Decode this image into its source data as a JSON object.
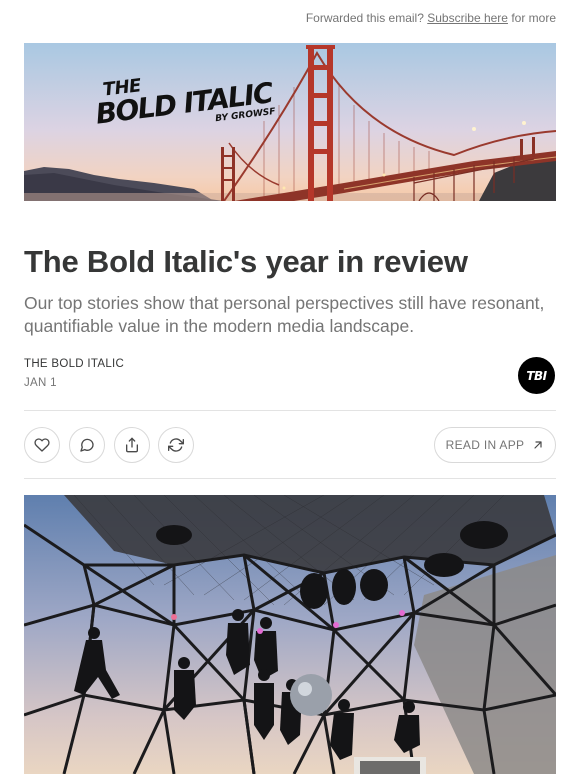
{
  "header": {
    "forward_text": "Forwarded this email?",
    "subscribe_link": "Subscribe here",
    "forward_suffix": "for more"
  },
  "hero_logo": {
    "line1": "THE",
    "line2": "BOLD ITALIC",
    "line3": "BY GROWSF"
  },
  "post": {
    "title": "The Bold Italic's year in review",
    "subtitle": "Our top stories show that personal perspectives still have resonant, quantifiable value in the modern media landscape.",
    "author": "THE BOLD ITALIC",
    "date": "JAN 1",
    "publication_logo": "TBI"
  },
  "actions": {
    "like_icon": "heart-icon",
    "comment_icon": "comment-icon",
    "share_icon": "share-icon",
    "restack_icon": "restack-icon",
    "read_in_app_label": "READ IN APP",
    "read_in_app_icon": "arrow-up-right-icon"
  },
  "colors": {
    "text_primary": "#363737",
    "text_secondary": "#757575",
    "border": "#d9d9d9",
    "bridge": "#b5372a"
  }
}
